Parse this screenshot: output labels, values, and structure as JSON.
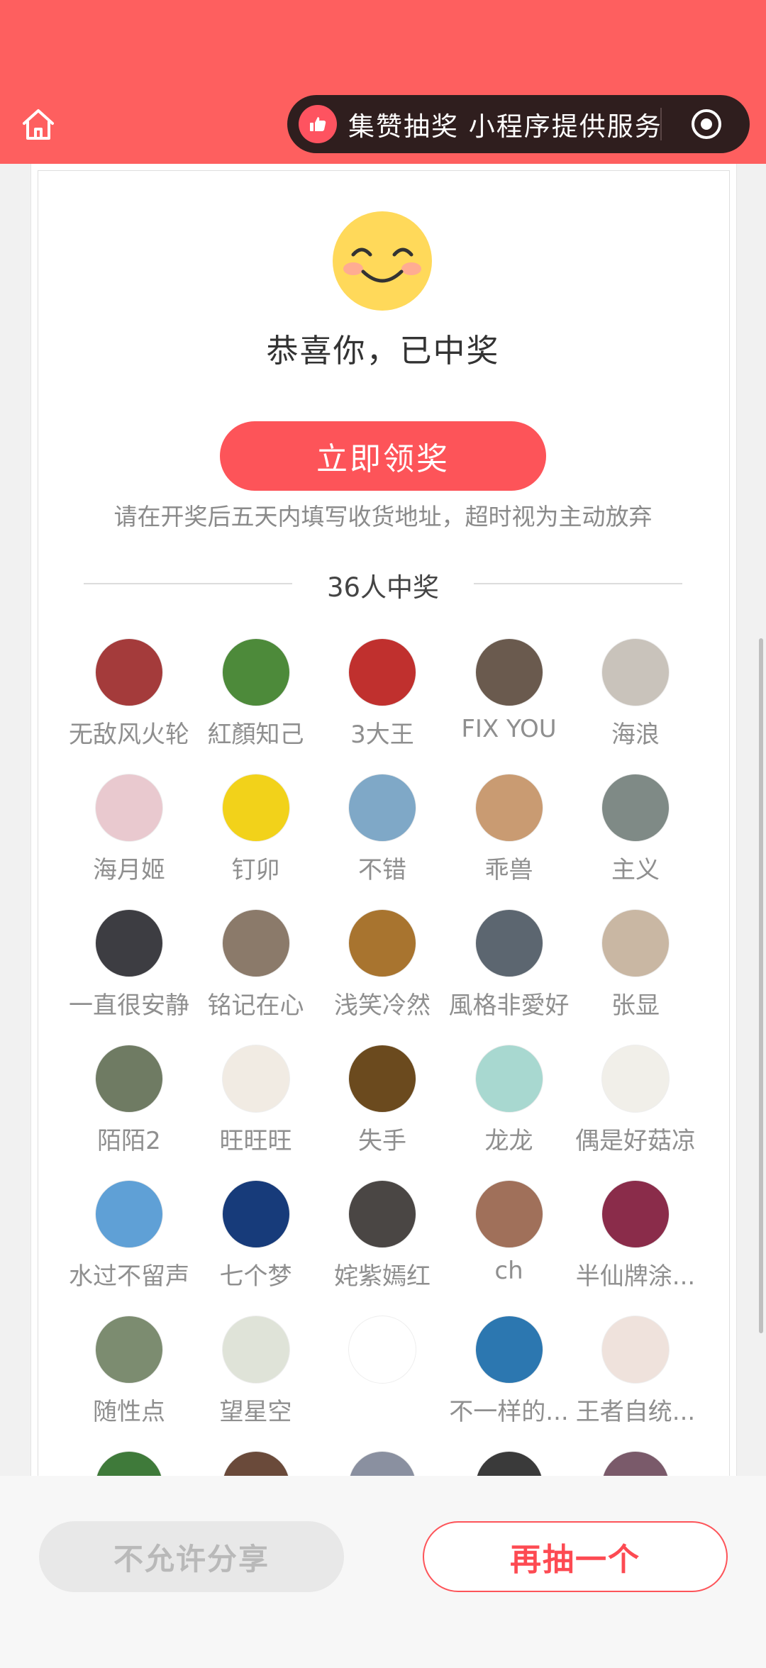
{
  "header": {
    "mini_program_name": "集赞抽奖 小程序提供服务",
    "color": "#fe5f5f"
  },
  "result": {
    "congrats": "恭喜你，已中奖",
    "claim_button": "立即领奖",
    "notice": "请在开奖后五天内填写收货地址，超时视为主动放弃",
    "winners_title": "36人中奖"
  },
  "winners": [
    {
      "name": "无敌风火轮",
      "color": "#a43b3b"
    },
    {
      "name": "紅顏知己",
      "color": "#4d8a3a"
    },
    {
      "name": "3大王",
      "color": "#c0302e"
    },
    {
      "name": "FIX YOU",
      "color": "#6a5a4e"
    },
    {
      "name": "海浪",
      "color": "#c9c3bb"
    },
    {
      "name": "海月姬",
      "color": "#e9c9cf"
    },
    {
      "name": "钉卯",
      "color": "#f2d21a"
    },
    {
      "name": "不错",
      "color": "#7fa8c7"
    },
    {
      "name": "乖兽",
      "color": "#c99b72"
    },
    {
      "name": "主义",
      "color": "#7f8a86"
    },
    {
      "name": "一直很安静",
      "color": "#3d3d42"
    },
    {
      "name": "铭记在心",
      "color": "#8b7a6a"
    },
    {
      "name": "浅笑冷然",
      "color": "#a8742f"
    },
    {
      "name": "風格非愛好",
      "color": "#5c6670"
    },
    {
      "name": "张显",
      "color": "#c9b7a3"
    },
    {
      "name": "陌陌2",
      "color": "#6f7b63"
    },
    {
      "name": "旺旺旺",
      "color": "#f1ebe3"
    },
    {
      "name": "失手",
      "color": "#6b4a1e"
    },
    {
      "name": "龙龙",
      "color": "#a8d8d0"
    },
    {
      "name": "偶是好菇凉",
      "color": "#f1efe9"
    },
    {
      "name": "水过不留声",
      "color": "#5fa0d6"
    },
    {
      "name": "七个梦",
      "color": "#173b7a"
    },
    {
      "name": "姹紫嫣红",
      "color": "#4a4644"
    },
    {
      "name": "ch",
      "color": "#a0705a"
    },
    {
      "name": "半仙牌涂...",
      "color": "#8a2c4a"
    },
    {
      "name": "随性点",
      "color": "#7c8c70"
    },
    {
      "name": "望星空",
      "color": "#dfe3d8"
    },
    {
      "name": "",
      "color": "#ffffff"
    },
    {
      "name": "不一样的...",
      "color": "#2c77b0"
    },
    {
      "name": "王者自统...",
      "color": "#efe2dc"
    },
    {
      "name": "",
      "color": "#3f7a3a"
    },
    {
      "name": "",
      "color": "#6a4a3a"
    },
    {
      "name": "",
      "color": "#8a90a0"
    },
    {
      "name": "",
      "color": "#3a3a3a"
    },
    {
      "name": "",
      "color": "#7a5a6a"
    }
  ],
  "bottom": {
    "share_button": "不允许分享",
    "again_button": "再抽一个"
  }
}
